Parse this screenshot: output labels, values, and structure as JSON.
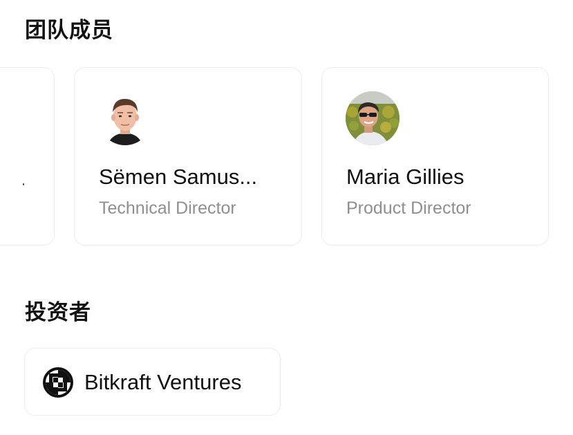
{
  "team": {
    "title": "团队成员",
    "members": [
      {
        "name": "Sëmen Samus...",
        "role": "Technical Director",
        "avatar": "person-photo"
      },
      {
        "name": "Maria Gillies",
        "role": "Product Director",
        "avatar": "person-photo"
      }
    ]
  },
  "investors": {
    "title": "投资者",
    "items": [
      {
        "name": "Bitkraft Ventures",
        "logo": "bitkraft-logo-icon"
      }
    ]
  }
}
